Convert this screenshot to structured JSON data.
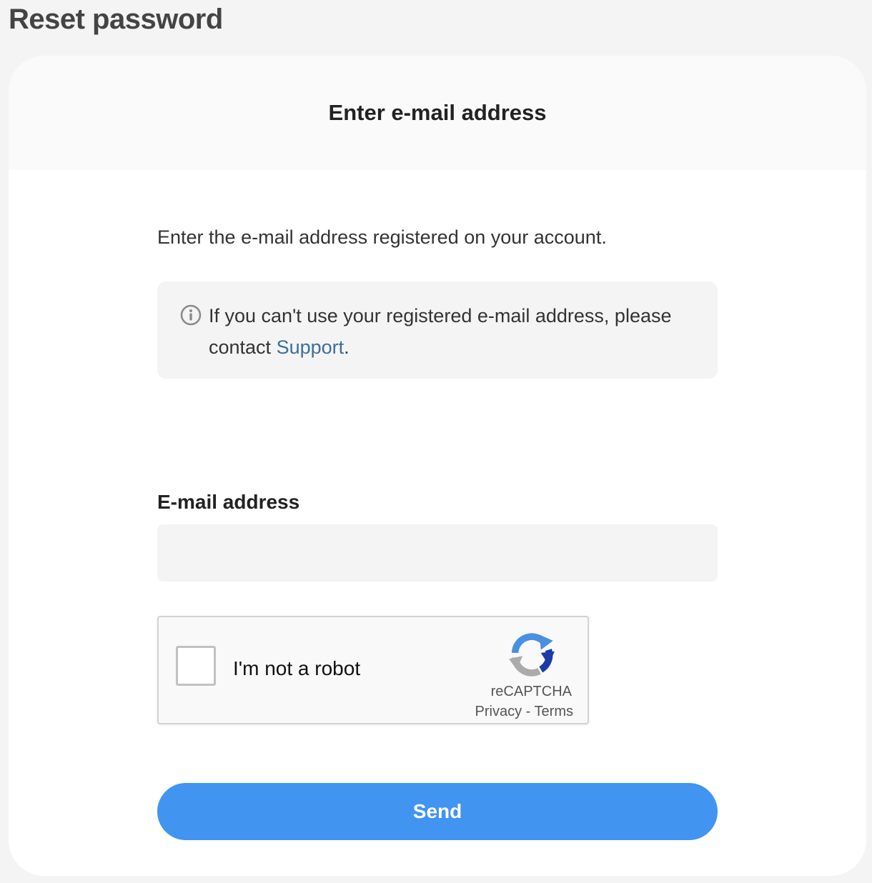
{
  "page": {
    "title": "Reset password"
  },
  "card": {
    "heading": "Enter e-mail address",
    "intro": "Enter the e-mail address registered on your account.",
    "notice": {
      "icon": "info-icon",
      "text_before": "If you can't use your registered e-mail address, please contact ",
      "link_label": "Support",
      "text_after": "."
    },
    "email_field": {
      "label": "E-mail address",
      "value": "",
      "placeholder": ""
    },
    "captcha": {
      "label": "I'm not a robot",
      "checked": false,
      "brand": "reCAPTCHA",
      "privacy_label": "Privacy",
      "separator": " - ",
      "terms_label": "Terms",
      "icon": "recaptcha-logo-icon"
    },
    "send_label": "Send"
  },
  "colors": {
    "background": "#f4f4f4",
    "card": "#ffffff",
    "header": "#fafafa",
    "link": "#3d6e99",
    "primary_button": "#4194f0"
  }
}
